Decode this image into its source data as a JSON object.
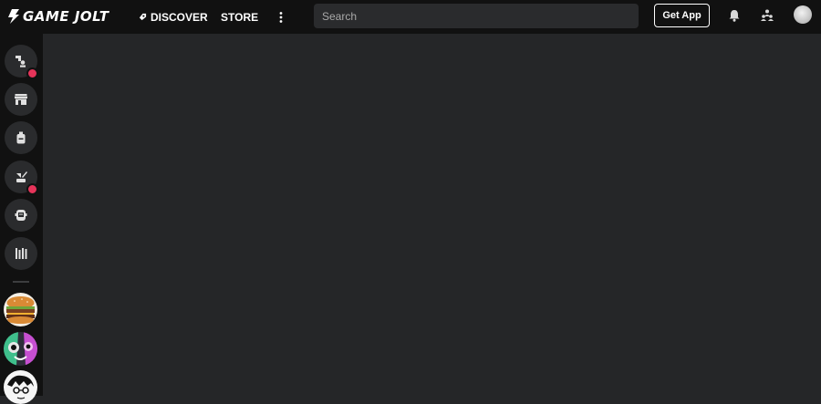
{
  "app": {
    "logo_text": "GAME JOLT"
  },
  "nav": {
    "discover_label": "DISCOVER",
    "store_label": "STORE",
    "more_icon": "more-vertical-icon"
  },
  "search": {
    "placeholder": "Search"
  },
  "header_actions": {
    "get_app_label": "Get App",
    "icons": [
      "bell-icon",
      "friends-icon",
      "user-avatar"
    ]
  },
  "sidebar": {
    "items": [
      {
        "name": "activity",
        "icon": "activity-icon",
        "has_notification": true
      },
      {
        "name": "store",
        "icon": "store-icon",
        "has_notification": false
      },
      {
        "name": "backpack",
        "icon": "backpack-icon",
        "has_notification": false
      },
      {
        "name": "creator",
        "icon": "creator-icon",
        "has_notification": true
      },
      {
        "name": "chat",
        "icon": "chat-icon",
        "has_notification": false
      },
      {
        "name": "library",
        "icon": "library-icon",
        "has_notification": false
      }
    ],
    "communities": [
      {
        "name": "community-burger"
      },
      {
        "name": "community-character"
      },
      {
        "name": "community-sketch"
      }
    ]
  },
  "colors": {
    "background": "#252628",
    "chrome": "#111111",
    "notification": "#e6345a"
  }
}
